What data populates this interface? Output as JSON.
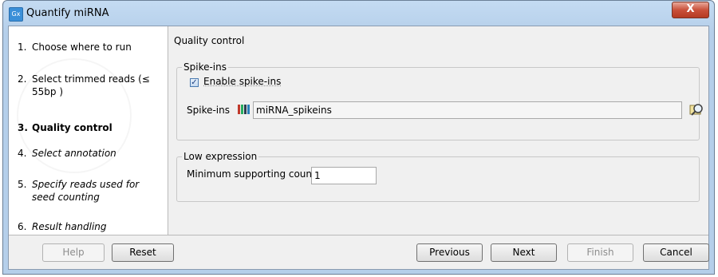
{
  "window": {
    "title": "Quantify miRNA",
    "app_icon_text": "Gx",
    "close_symbol": "X"
  },
  "steps": [
    {
      "num": "1.",
      "label": "Choose where to run"
    },
    {
      "num": "2.",
      "label": "Select trimmed reads (≤ 55bp )"
    },
    {
      "num": "3.",
      "label": "Quality control"
    },
    {
      "num": "4.",
      "label": "Select annotation"
    },
    {
      "num": "5.",
      "label": "Specify reads used for seed counting"
    },
    {
      "num": "6.",
      "label": "Result handling"
    }
  ],
  "main": {
    "section_title": "Quality control",
    "spike_ins_group": {
      "legend": "Spike-ins",
      "enable_checkbox_label": "Enable spike-ins",
      "enable_checked": true,
      "field_label": "Spike-ins",
      "field_value": "miRNA_spikeins"
    },
    "low_expression_group": {
      "legend": "Low expression",
      "min_count_label": "Minimum supporting count",
      "min_count_value": "1"
    }
  },
  "footer": {
    "help": "Help",
    "reset": "Reset",
    "previous": "Previous",
    "next": "Next",
    "finish": "Finish",
    "cancel": "Cancel"
  }
}
